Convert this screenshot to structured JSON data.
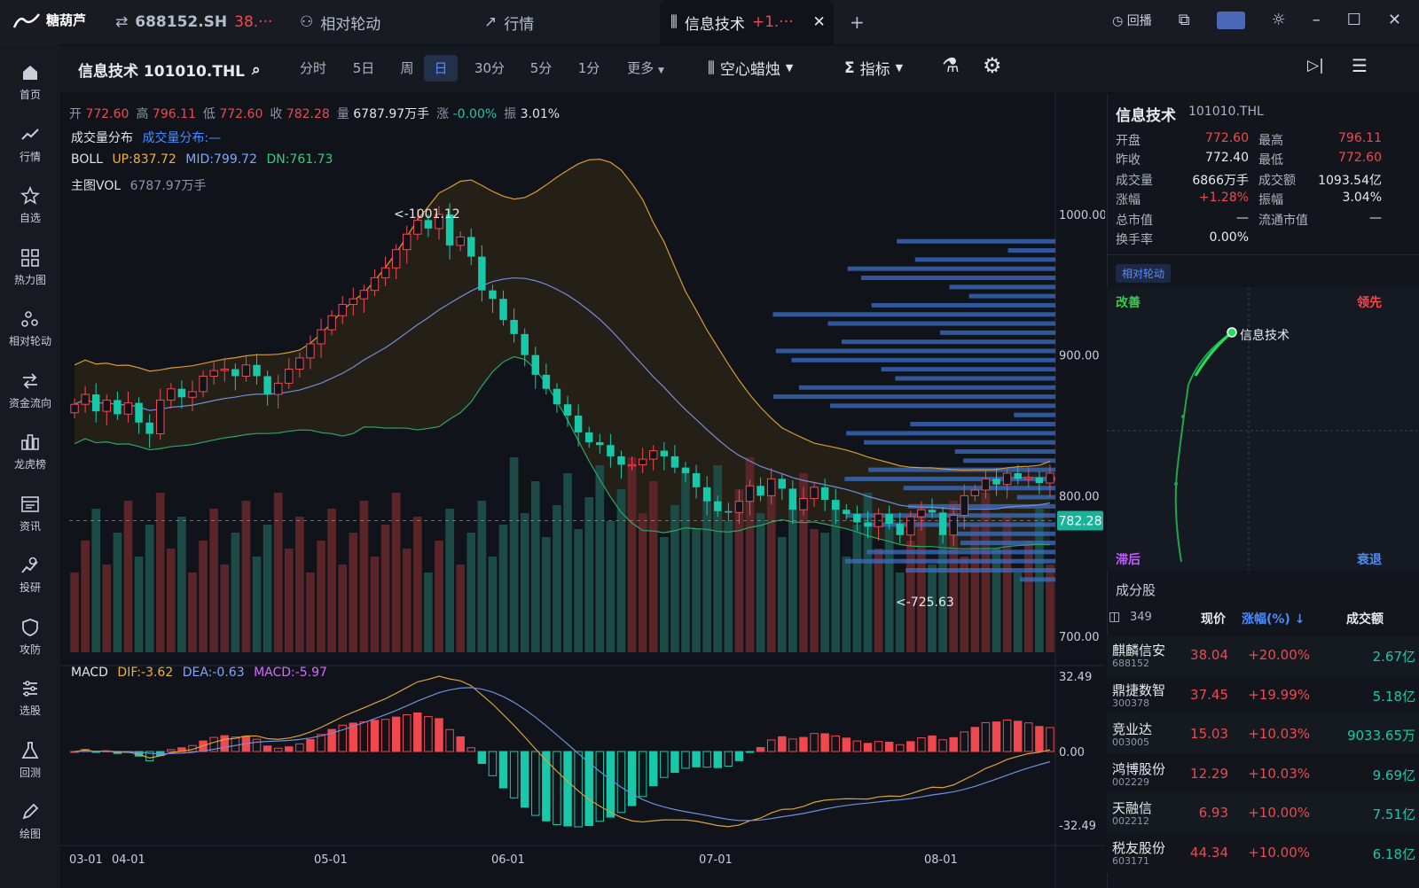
{
  "app": {
    "logo_text": "糖葫芦"
  },
  "tabs": [
    {
      "label": "688152.SH",
      "extra": "38.···"
    },
    {
      "label": "相对轮动"
    },
    {
      "label": "行情"
    },
    {
      "label": "信息技术",
      "extra": "+1.···"
    }
  ],
  "top_right": {
    "replay": "回播"
  },
  "sidebar": [
    {
      "label": "首页",
      "icon": "home-icon"
    },
    {
      "label": "行情",
      "icon": "trend-icon"
    },
    {
      "label": "自选",
      "icon": "star-icon"
    },
    {
      "label": "热力图",
      "icon": "grid-icon"
    },
    {
      "label": "相对轮动",
      "icon": "rotation-icon"
    },
    {
      "label": "资金流向",
      "icon": "flow-icon"
    },
    {
      "label": "龙虎榜",
      "icon": "bar-icon"
    },
    {
      "label": "资讯",
      "icon": "news-icon"
    },
    {
      "label": "投研",
      "icon": "research-icon"
    },
    {
      "label": "攻防",
      "icon": "shield-icon"
    },
    {
      "label": "选股",
      "icon": "filter-icon"
    },
    {
      "label": "回测",
      "icon": "flask-icon"
    },
    {
      "label": "绘图",
      "icon": "pen-icon"
    }
  ],
  "toolbar": {
    "title": "信息技术 101010.THL",
    "periods": [
      "分时",
      "5日",
      "周",
      "日",
      "30分",
      "5分",
      "1分",
      "更多"
    ],
    "selected_period": "日",
    "candle_style": "空心蜡烛",
    "indicator": "指标"
  },
  "ohlc": {
    "open_label": "开",
    "open": "772.60",
    "high_label": "高",
    "high": "796.11",
    "low_label": "低",
    "low": "772.60",
    "close_label": "收",
    "close": "782.28",
    "vol_label": "量",
    "vol": "6787.97万手",
    "chg_label": "涨",
    "chg": "-0.00%",
    "amp_label": "振",
    "amp": "3.01%"
  },
  "legend": {
    "vol_dist": "成交量分布",
    "vol_dist_val": "成交量分布:—",
    "boll": "BOLL",
    "boll_up": "UP:837.72",
    "boll_mid": "MID:799.72",
    "boll_dn": "DN:761.73",
    "main_vol": "主图VOL",
    "main_vol_val": "6787.97万手",
    "macd": "MACD",
    "dif": "DIF:-3.62",
    "dea": "DEA:-0.63",
    "macd_val": "MACD:-5.97"
  },
  "annotations": {
    "high_mark": "<-1001.12",
    "low_mark": "<-725.63",
    "last_price": "782.28"
  },
  "chart_data": {
    "type": "candlestick",
    "price_axis": [
      "1000.00",
      "900.00",
      "800.00",
      "700.00"
    ],
    "price_ylim": [
      700,
      1000
    ],
    "macd_axis": [
      "32.49",
      "0.00",
      "-32.49"
    ],
    "macd_ylim": [
      -32.49,
      32.49
    ],
    "x_labels": [
      "03-01",
      "04-01",
      "05-01",
      "06-01",
      "07-01",
      "08-01"
    ],
    "closes": [
      865,
      872,
      860,
      868,
      858,
      866,
      852,
      844,
      868,
      876,
      870,
      874,
      885,
      889,
      890,
      885,
      893,
      885,
      872,
      880,
      890,
      898,
      908,
      918,
      928,
      936,
      940,
      946,
      955,
      962,
      975,
      986,
      996,
      990,
      1000,
      978,
      984,
      970,
      946,
      940,
      925,
      915,
      900,
      886,
      876,
      865,
      857,
      845,
      838,
      836,
      828,
      822,
      822,
      826,
      832,
      828,
      820,
      816,
      806,
      796,
      789,
      788,
      796,
      807,
      800,
      812,
      805,
      790,
      798,
      806,
      797,
      790,
      787,
      781,
      778,
      787,
      780,
      772,
      785,
      790,
      788,
      772,
      786,
      800,
      804,
      812,
      808,
      816,
      812,
      813,
      809,
      816
    ],
    "vol_distribution_note": "horizontal volume profile"
  },
  "right_panel": {
    "title": "信息技术",
    "code": "101010.THL",
    "quotes": [
      {
        "k1": "开盘",
        "v1": "772.60",
        "c1": "red",
        "k2": "最高",
        "v2": "796.11",
        "c2": "red"
      },
      {
        "k1": "昨收",
        "v1": "772.40",
        "c1": "white",
        "k2": "最低",
        "v2": "772.60",
        "c2": "red"
      },
      {
        "k1": "成交量",
        "v1": "6866万手",
        "c1": "white",
        "k2": "成交额",
        "v2": "1093.54亿",
        "c2": "white"
      },
      {
        "k1": "涨幅",
        "v1": "+1.28%",
        "c1": "red",
        "k2": "振幅",
        "v2": "3.04%",
        "c2": "white"
      },
      {
        "k1": "总市值",
        "v1": "—",
        "c1": "white",
        "k2": "流通市值",
        "v2": "—",
        "c2": "white"
      },
      {
        "k1": "换手率",
        "v1": "0.00%",
        "c1": "white",
        "k2": "",
        "v2": "",
        "c2": "white"
      }
    ],
    "rotation_badge": "相对轮动",
    "rotation": {
      "improve": "改善",
      "lead": "领先",
      "lag": "滞后",
      "decline": "衰退",
      "point_label": "信息技术"
    },
    "constituents_title": "成分股",
    "table_count": "349",
    "table_headers": {
      "price": "现价",
      "change": "涨幅(%)",
      "amount": "成交额"
    },
    "rows": [
      {
        "name": "麒麟信安",
        "code": "688152",
        "price": "38.04",
        "change": "+20.00%",
        "amount": "2.67亿"
      },
      {
        "name": "鼎捷数智",
        "code": "300378",
        "price": "37.45",
        "change": "+19.99%",
        "amount": "5.18亿"
      },
      {
        "name": "竞业达",
        "code": "003005",
        "price": "15.03",
        "change": "+10.03%",
        "amount": "9033.65万"
      },
      {
        "name": "鸿博股份",
        "code": "002229",
        "price": "12.29",
        "change": "+10.03%",
        "amount": "9.69亿"
      },
      {
        "name": "天融信",
        "code": "002212",
        "price": "6.93",
        "change": "+10.00%",
        "amount": "7.51亿"
      },
      {
        "name": "税友股份",
        "code": "603171",
        "price": "44.34",
        "change": "+10.00%",
        "amount": "6.18亿"
      }
    ]
  }
}
